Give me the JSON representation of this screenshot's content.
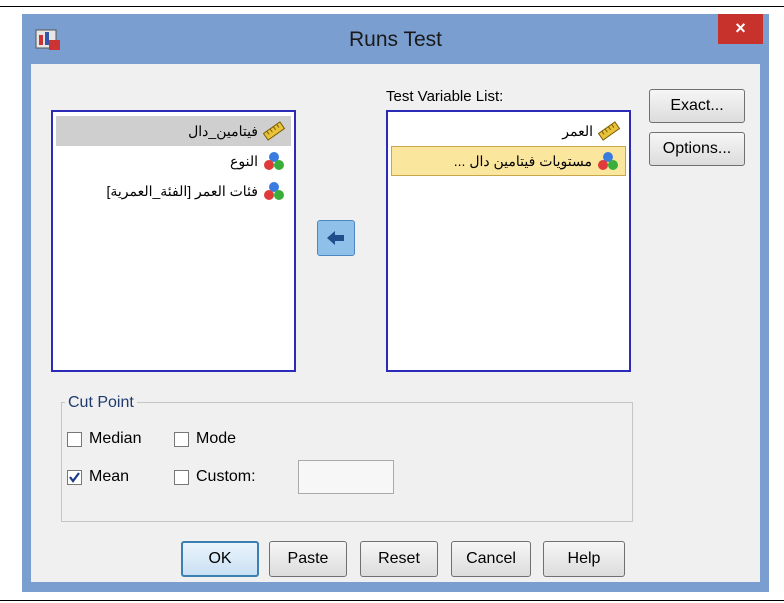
{
  "window": {
    "title": "Runs Test",
    "close_label": "×"
  },
  "source_list": {
    "items": [
      {
        "label": "فيتامين_دال",
        "icon": "ruler-scale-icon",
        "selected": true
      },
      {
        "label": "النوع",
        "icon": "nominal-balls-icon",
        "selected": false
      },
      {
        "label": "فئات العمر [الفئة_العمرية]",
        "icon": "nominal-balls-icon",
        "selected": false
      }
    ]
  },
  "target_list": {
    "label": "Test Variable List:",
    "items": [
      {
        "label": "العمر",
        "icon": "ruler-scale-icon",
        "selected": false
      },
      {
        "label": "مستويات فيتامين دال ...",
        "icon": "nominal-balls-icon",
        "selected": true
      }
    ]
  },
  "side_buttons": {
    "exact": "Exact...",
    "options": "Options..."
  },
  "cut_point": {
    "title": "Cut Point",
    "median": {
      "label": "Median",
      "checked": false
    },
    "mode": {
      "label": "Mode",
      "checked": false
    },
    "mean": {
      "label": "Mean",
      "checked": true
    },
    "custom": {
      "label": "Custom:",
      "checked": false,
      "value": ""
    }
  },
  "footer": {
    "ok": "OK",
    "paste": "Paste",
    "reset": "Reset",
    "cancel": "Cancel",
    "help": "Help"
  },
  "colors": {
    "frame": "#7a9ed0",
    "close": "#c7332c",
    "list_border": "#2b2bb8",
    "selection_yellow": "#fbe69d"
  }
}
